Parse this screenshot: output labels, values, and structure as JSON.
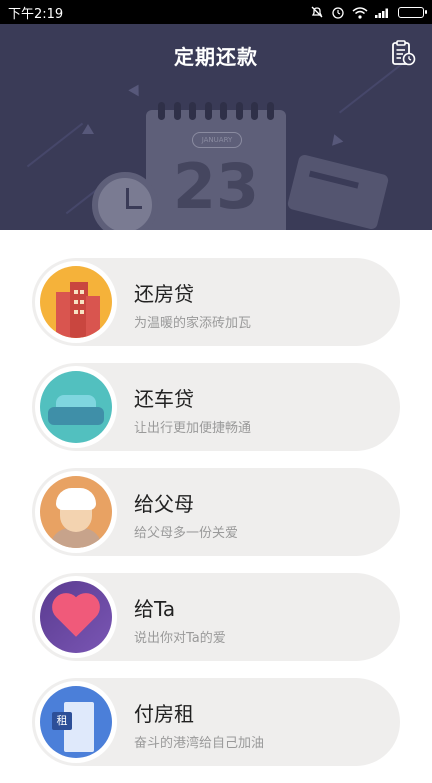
{
  "status_bar": {
    "time": "下午2:19"
  },
  "header": {
    "title": "定期还款",
    "calendar_month": "JANUARY",
    "calendar_day": "23"
  },
  "items": [
    {
      "title": "还房贷",
      "subtitle": "为温暖的家添砖加瓦",
      "icon": "house-loan-icon"
    },
    {
      "title": "还车贷",
      "subtitle": "让出行更加便捷畅通",
      "icon": "car-loan-icon"
    },
    {
      "title": "给父母",
      "subtitle": "给父母多一份关爱",
      "icon": "parents-icon"
    },
    {
      "title": "给Ta",
      "subtitle": "说出你对Ta的爱",
      "icon": "heart-icon"
    },
    {
      "title": "付房租",
      "subtitle": "奋斗的港湾给自己加油",
      "icon": "rent-icon",
      "icon_tag": "租"
    }
  ],
  "colors": {
    "header_bg": "#3a3b57",
    "item_bg": "#efeeed",
    "accent_house": "#f5b23a",
    "accent_car": "#52c0bf",
    "accent_parents": "#e8a263",
    "accent_ta": "#6a4aa4",
    "accent_rent": "#4b7fd9"
  }
}
